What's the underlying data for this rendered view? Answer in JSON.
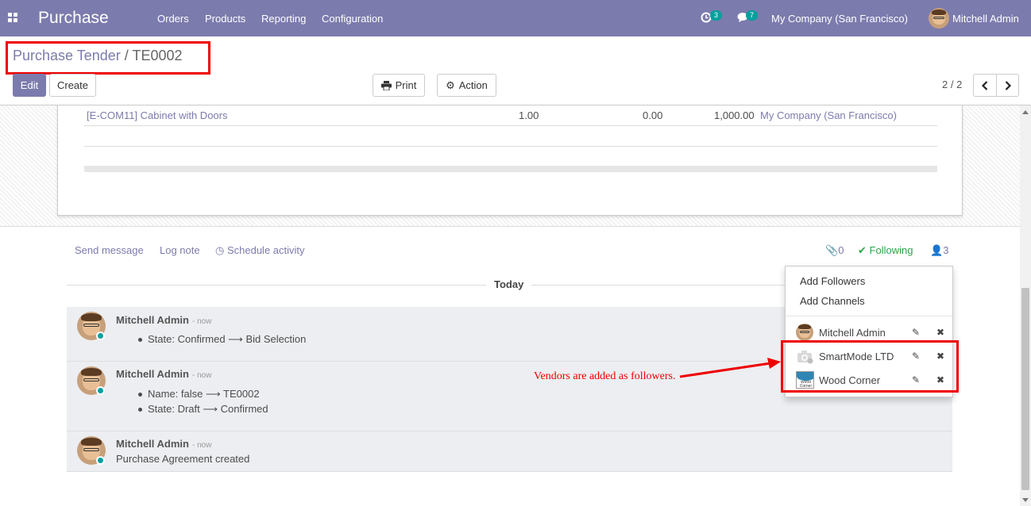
{
  "topbar": {
    "app_name": "Purchase",
    "menu": [
      "Orders",
      "Products",
      "Reporting",
      "Configuration"
    ],
    "activity_count": "3",
    "message_count": "7",
    "company": "My Company (San Francisco)",
    "user": "Mitchell Admin"
  },
  "control_panel": {
    "breadcrumb_parent": "Purchase Tender",
    "breadcrumb_sep": "/",
    "breadcrumb_current": "TE0002",
    "edit_label": "Edit",
    "create_label": "Create",
    "print_label": "Print",
    "action_label": "Action",
    "pager": "2 / 2"
  },
  "lines": {
    "row1": {
      "product": "[E-COM11] Cabinet with Doors",
      "quantity": "1.00",
      "ordered": "0.00",
      "price": "1,000.00",
      "company": "My Company (San Francisco)"
    }
  },
  "chatter": {
    "send_message": "Send message",
    "log_note": "Log note",
    "schedule_activity": "Schedule activity",
    "attachments": "0",
    "following": "Following",
    "followers_count": "3",
    "today": "Today",
    "messages": [
      {
        "author": "Mitchell Admin",
        "date": "- now",
        "items": [
          "State: Confirmed",
          "Bid Selection"
        ]
      },
      {
        "author": "Mitchell Admin",
        "date": "- now",
        "items": [
          "Name: false",
          "TE0002",
          "State: Draft",
          "Confirmed"
        ]
      },
      {
        "author": "Mitchell Admin",
        "date": "- now",
        "text": "Purchase Agreement created"
      }
    ]
  },
  "followers_dropdown": {
    "add_followers": "Add Followers",
    "add_channels": "Add Channels",
    "followers": [
      "Mitchell Admin",
      "SmartMode LTD",
      "Wood Corner"
    ],
    "wood_logo_text": "Wood Corner"
  },
  "annotation": {
    "text": "Vendors are added as followers.",
    "color": "#e00000"
  },
  "colors": {
    "brand": "#7c7bad",
    "online": "#00a09d",
    "following": "#28a745"
  }
}
